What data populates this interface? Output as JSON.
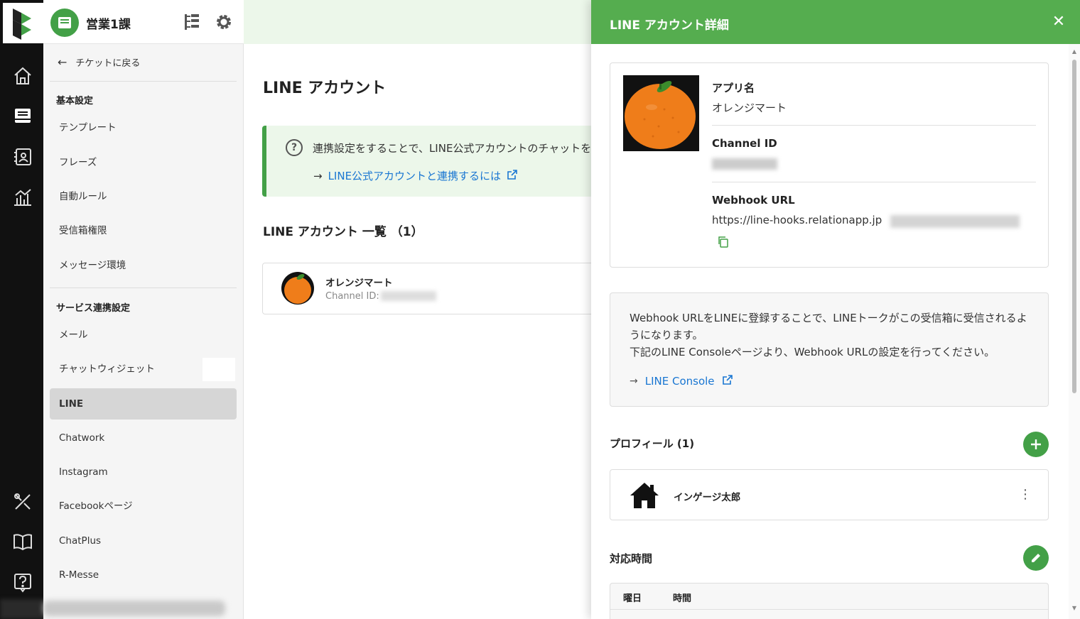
{
  "header": {
    "team_name": "営業1課"
  },
  "sidebar": {
    "back_label": "チケットに戻る",
    "sections": [
      {
        "title": "基本設定",
        "items": [
          "テンプレート",
          "フレーズ",
          "自動ルール",
          "受信箱権限",
          "メッセージ環境"
        ]
      },
      {
        "title": "サービス連携設定",
        "items": [
          "メール",
          "チャットウィジェット",
          "LINE",
          "Chatwork",
          "Instagram",
          "Facebookページ",
          "ChatPlus",
          "R-Messe"
        ]
      }
    ],
    "active_item": "LINE"
  },
  "main": {
    "page_title": "LINE アカウント",
    "notice_text": "連携設定をすることで、LINE公式アカウントのチャットを",
    "notice_link": "LINE公式アカウントと連携するには",
    "list_title": "LINE アカウント 一覧 （1）",
    "account": {
      "name": "オレンジマート",
      "channel_label": "Channel ID:"
    }
  },
  "drawer": {
    "title": "LINE アカウント詳細",
    "app_name_label": "アプリ名",
    "app_name_value": "オレンジマート",
    "channel_id_label": "Channel ID",
    "webhook_label": "Webhook URL",
    "webhook_value": "https://line-hooks.relationapp.jp",
    "info_text_1": "Webhook URLをLINEに登録することで、LINEトークがこの受信箱に受信されるようになります。",
    "info_text_2": "下記のLINE Consoleページより、Webhook URLの設定を行ってください。",
    "console_link": "LINE Console",
    "profile_title": "プロフィール (1)",
    "profile_name": "インゲージ太郎",
    "hours_title": "対応時間",
    "hours_columns": [
      "曜日",
      "時間"
    ]
  },
  "colors": {
    "accent_green": "#43a047",
    "header_green": "#55ad4f",
    "link_blue": "#1976d2"
  }
}
